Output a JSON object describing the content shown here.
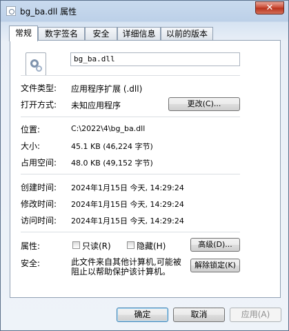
{
  "window": {
    "title": "bg_ba.dll 属性",
    "close_label": "✕"
  },
  "tabs": [
    "常规",
    "数字签名",
    "安全",
    "详细信息",
    "以前的版本"
  ],
  "general": {
    "file_name": "bg_ba.dll",
    "file_type_label": "文件类型:",
    "file_type_value": "应用程序扩展 (.dll)",
    "opens_with_label": "打开方式:",
    "opens_with_value": "未知应用程序",
    "change_button": "更改(C)...",
    "location_label": "位置:",
    "location_value": "C:\\2022\\4\\bg_ba.dll",
    "size_label": "大小:",
    "size_value": "45.1 KB (46,224 字节)",
    "size_on_disk_label": "占用空间:",
    "size_on_disk_value": "48.0 KB (49,152 字节)",
    "created_label": "创建时间:",
    "created_value": "2024年1月15日 今天, 14:29:24",
    "modified_label": "修改时间:",
    "modified_value": "2024年1月15日 今天, 14:29:24",
    "accessed_label": "访问时间:",
    "accessed_value": "2024年1月15日 今天, 14:29:24",
    "attributes_label": "属性:",
    "readonly_label": "只读(R)",
    "hidden_label": "隐藏(H)",
    "advanced_button": "高级(D)...",
    "security_label": "安全:",
    "security_text": "此文件来自其他计算机,可能被阻止以帮助保护该计算机。",
    "unblock_button": "解除锁定(K)"
  },
  "footer": {
    "ok": "确定",
    "cancel": "取消",
    "apply": "应用(A)"
  }
}
